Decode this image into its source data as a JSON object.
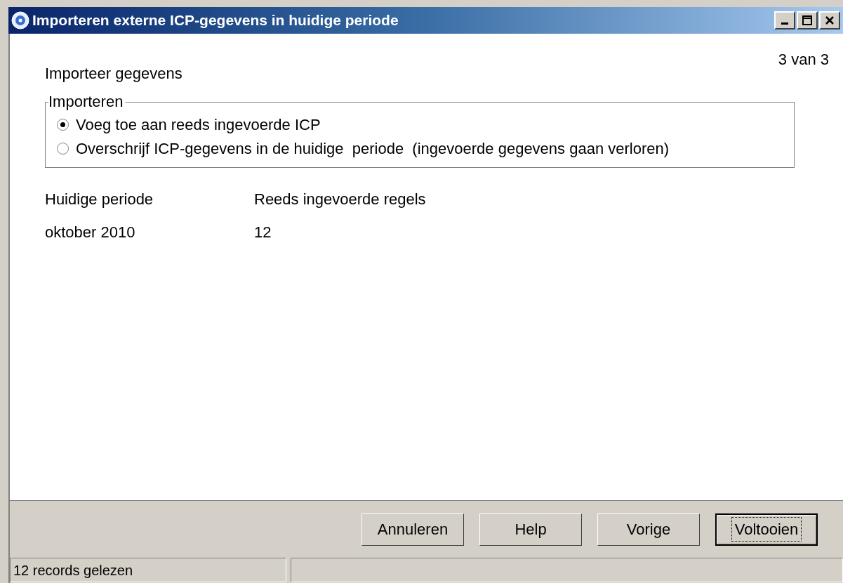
{
  "window": {
    "title": "Importeren externe ICP-gegevens in huidige periode"
  },
  "step": "3 van 3",
  "heading": "Importeer gegevens",
  "group": {
    "label": "Importeren",
    "options": [
      {
        "label": "Voeg toe aan reeds ingevoerde ICP",
        "selected": true
      },
      {
        "label": "Overschrijf ICP-gegevens in de huidige  periode  (ingevoerde gegevens gaan verloren)",
        "selected": false
      }
    ]
  },
  "info": {
    "columns": [
      {
        "label": "Huidige periode",
        "value": "oktober 2010"
      },
      {
        "label": "Reeds ingevoerde regels",
        "value": "12"
      }
    ]
  },
  "buttons": [
    {
      "label": "Annuleren",
      "default": false
    },
    {
      "label": "Help",
      "default": false
    },
    {
      "label": "Vorige",
      "default": false
    },
    {
      "label": "Voltooien",
      "default": true
    }
  ],
  "status_bar": {
    "text": "12 records gelezen"
  }
}
